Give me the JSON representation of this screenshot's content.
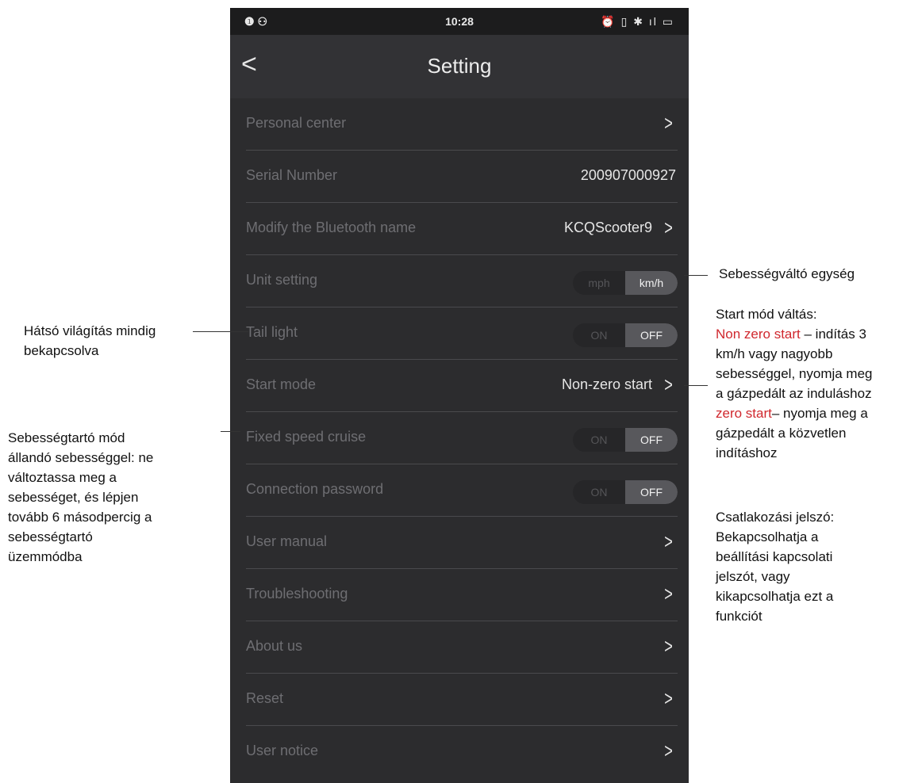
{
  "status_bar": {
    "left_icons": "❶ ⚇",
    "time": "10:28",
    "right_icons": "⏰ ▯ ✱ ıl ▭"
  },
  "header": {
    "back_icon": "chevron-left-icon",
    "back_glyph": "<",
    "title": "Setting"
  },
  "settings": {
    "personal_center": {
      "label": "Personal center"
    },
    "serial_number": {
      "label": "Serial Number",
      "value": "200907000927"
    },
    "bluetooth_name": {
      "label": "Modify the Bluetooth name",
      "value": "KCQScooter9"
    },
    "unit_setting": {
      "label": "Unit setting",
      "option_a": "mph",
      "option_b": "km/h",
      "selected": "km/h"
    },
    "tail_light": {
      "label": "Tail light",
      "option_a": "ON",
      "option_b": "OFF",
      "selected": "OFF"
    },
    "start_mode": {
      "label": "Start mode",
      "value": "Non-zero start"
    },
    "fixed_speed_cruise": {
      "label": "Fixed speed cruise",
      "option_a": "ON",
      "option_b": "OFF",
      "selected": "OFF"
    },
    "connection_password": {
      "label": "Connection password",
      "option_a": "ON",
      "option_b": "OFF",
      "selected": "OFF"
    },
    "user_manual": {
      "label": "User manual"
    },
    "troubleshooting": {
      "label": "Troubleshooting"
    },
    "about_us": {
      "label": "About us"
    },
    "reset": {
      "label": "Reset"
    },
    "user_notice": {
      "label": "User notice"
    }
  },
  "chevron_glyph": ">",
  "annotations": {
    "unit": "Sebességváltó egység",
    "tail_light": [
      "Hátsó világítás mindig",
      "bekapcsolva"
    ],
    "start_mode": {
      "title": "Start mód váltás:",
      "non_zero_red": "Non zero start",
      "non_zero_rest_1": " – indítás 3",
      "line2": "km/h vagy nagyobb",
      "line3": "sebességgel, nyomja meg",
      "line4": "a gázpedált az induláshoz",
      "zero_red": "zero start",
      "zero_rest": "– nyomja meg a",
      "line6": "gázpedált a közvetlen",
      "line7": "indításhoz"
    },
    "cruise": [
      "Sebességtartó mód",
      "állandó sebességgel: ne",
      "változtassa meg a",
      "sebességet, és lépjen",
      "tovább 6 másodpercig a",
      "sebességtartó",
      "üzemmódba"
    ],
    "password": [
      "Csatlakozási jelszó:",
      "Bekapcsolhatja a",
      "beállítási kapcsolati",
      "jelszót, vagy",
      "kikapcsolhatja ezt a",
      "funkciót"
    ]
  },
  "colors": {
    "annotation_highlight": "#d0282e",
    "screen_bg": "#2c2c2e"
  }
}
